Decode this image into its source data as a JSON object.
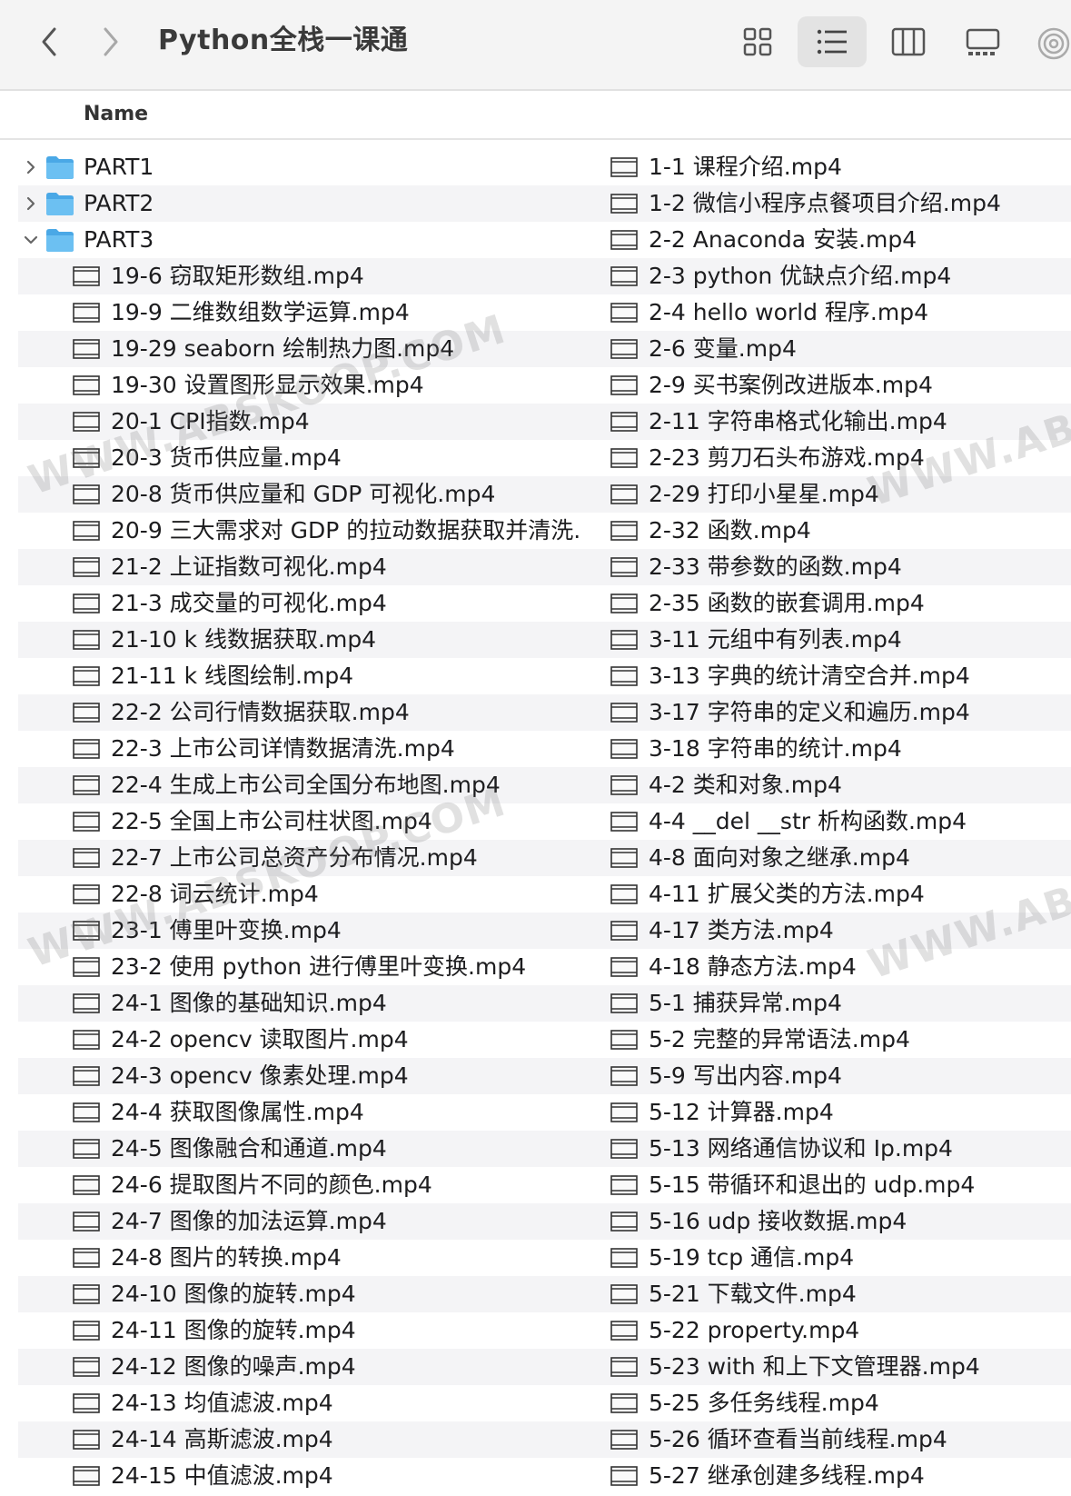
{
  "window": {
    "title": "Python全栈一课通"
  },
  "header": {
    "name_column": "Name"
  },
  "left_rows": [
    {
      "kind": "folder",
      "label": "PART1",
      "expanded": false
    },
    {
      "kind": "folder",
      "label": "PART2",
      "expanded": false
    },
    {
      "kind": "folder",
      "label": "PART3",
      "expanded": true
    },
    {
      "kind": "file",
      "label": "19-6 窃取矩形数组.mp4"
    },
    {
      "kind": "file",
      "label": "19-9 二维数组数学运算.mp4"
    },
    {
      "kind": "file",
      "label": "19-29 seaborn 绘制热力图.mp4"
    },
    {
      "kind": "file",
      "label": "19-30 设置图形显示效果.mp4"
    },
    {
      "kind": "file",
      "label": "20-1 CPI指数.mp4"
    },
    {
      "kind": "file",
      "label": "20-3 货币供应量.mp4"
    },
    {
      "kind": "file",
      "label": "20-8 货币供应量和 GDP 可视化.mp4"
    },
    {
      "kind": "file",
      "label": "20-9 三大需求对 GDP 的拉动数据获取并清洗."
    },
    {
      "kind": "file",
      "label": "21-2 上证指数可视化.mp4"
    },
    {
      "kind": "file",
      "label": "21-3 成交量的可视化.mp4"
    },
    {
      "kind": "file",
      "label": "21-10 k 线数据获取.mp4"
    },
    {
      "kind": "file",
      "label": "21-11 k 线图绘制.mp4"
    },
    {
      "kind": "file",
      "label": "22-2 公司行情数据获取.mp4"
    },
    {
      "kind": "file",
      "label": "22-3 上市公司详情数据清洗.mp4"
    },
    {
      "kind": "file",
      "label": "22-4 生成上市公司全国分布地图.mp4"
    },
    {
      "kind": "file",
      "label": "22-5 全国上市公司柱状图.mp4"
    },
    {
      "kind": "file",
      "label": "22-7 上市公司总资产分布情况.mp4"
    },
    {
      "kind": "file",
      "label": "22-8 词云统计.mp4"
    },
    {
      "kind": "file",
      "label": "23-1 傅里叶变换.mp4"
    },
    {
      "kind": "file",
      "label": "23-2 使用 python 进行傅里叶变换.mp4"
    },
    {
      "kind": "file",
      "label": "24-1 图像的基础知识.mp4"
    },
    {
      "kind": "file",
      "label": "24-2 opencv 读取图片.mp4"
    },
    {
      "kind": "file",
      "label": "24-3 opencv 像素处理.mp4"
    },
    {
      "kind": "file",
      "label": "24-4 获取图像属性.mp4"
    },
    {
      "kind": "file",
      "label": "24-5 图像融合和通道.mp4"
    },
    {
      "kind": "file",
      "label": "24-6 提取图片不同的颜色.mp4"
    },
    {
      "kind": "file",
      "label": "24-7 图像的加法运算.mp4"
    },
    {
      "kind": "file",
      "label": "24-8 图片的转换.mp4"
    },
    {
      "kind": "file",
      "label": "24-10 图像的旋转.mp4"
    },
    {
      "kind": "file",
      "label": "24-11 图像的旋转.mp4"
    },
    {
      "kind": "file",
      "label": "24-12 图像的噪声.mp4"
    },
    {
      "kind": "file",
      "label": "24-13 均值滤波.mp4"
    },
    {
      "kind": "file",
      "label": "24-14 高斯滤波.mp4"
    },
    {
      "kind": "file",
      "label": "24-15 中值滤波.mp4"
    }
  ],
  "right_rows": [
    "1-1 课程介绍.mp4",
    "1-2 微信小程序点餐项目介绍.mp4",
    "2-2 Anaconda 安装.mp4",
    "2-3 python 优缺点介绍.mp4",
    "2-4 hello world 程序.mp4",
    "2-6 变量.mp4",
    "2-9 买书案例改进版本.mp4",
    "2-11 字符串格式化输出.mp4",
    "2-23 剪刀石头布游戏.mp4",
    "2-29 打印小星星.mp4",
    "2-32 函数.mp4",
    "2-33 带参数的函数.mp4",
    "2-35 函数的嵌套调用.mp4",
    "3-11 元组中有列表.mp4",
    "3-13 字典的统计清空合并.mp4",
    "3-17 字符串的定义和遍历.mp4",
    "3-18 字符串的统计.mp4",
    "4-2 类和对象.mp4",
    "4-4 __del __str 析构函数.mp4",
    "4-8 面向对象之继承.mp4",
    "4-11 扩展父类的方法.mp4",
    "4-17 类方法.mp4",
    "4-18 静态方法.mp4",
    "5-1 捕获异常.mp4",
    "5-2 完整的异常语法.mp4",
    "5-9 写出内容.mp4",
    "5-12 计算器.mp4",
    "5-13 网络通信协议和 Ip.mp4",
    "5-15 带循环和退出的 udp.mp4",
    "5-16 udp 接收数据.mp4",
    "5-19 tcp 通信.mp4",
    "5-21 下载文件.mp4",
    "5-22 property.mp4",
    "5-23 with 和上下文管理器.mp4",
    "5-25 多任务线程.mp4",
    "5-26 循环查看当前线程.mp4",
    "5-27 继承创建多线程.mp4"
  ],
  "watermarks": [
    "WWW.ABSKOOP.COM",
    "WWW.ABSK",
    "WWW.ABSKOOP.COM",
    "WWW.ABSK"
  ],
  "colors": {
    "folder": "#5bb5ec",
    "row_stripe": "#f4f4f6",
    "toolbar": "#f4f4f4"
  }
}
